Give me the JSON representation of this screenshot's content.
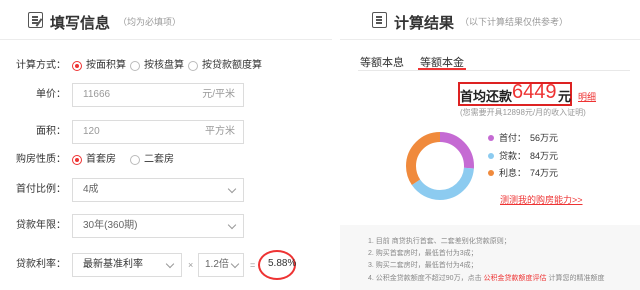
{
  "left": {
    "title": "填写信息",
    "subtitle": "（均为必填项）",
    "calc_method": {
      "label": "计算方式：",
      "options": [
        "按面积算",
        "按核盘算",
        "按贷款额度算"
      ],
      "selected": 0
    },
    "unit_price": {
      "label": "单价：",
      "placeholder": "11666",
      "unit": "元/平米"
    },
    "area": {
      "label": "面积：",
      "placeholder": "120",
      "unit": "平方米"
    },
    "house_type": {
      "label": "购房性质：",
      "options": [
        "首套房",
        "二套房"
      ],
      "selected": 0
    },
    "down_payment": {
      "label": "首付比例：",
      "value": "4成"
    },
    "loan_term": {
      "label": "贷款年限：",
      "value": "30年(360期)"
    },
    "loan_rate": {
      "label": "贷款利率：",
      "rate_type": "最新基准利率",
      "times_sign": "×",
      "multiplier": "1.2倍",
      "equals_sign": "=",
      "result": "5.88%"
    }
  },
  "right": {
    "title": "计算结果",
    "subtitle": "（以下计算结果仅供参考）",
    "tabs": [
      "等额本息",
      "等额本金"
    ],
    "active_tab": 1,
    "summary": {
      "label": "首均还款",
      "value": "6449",
      "unit": "元",
      "detail_link": "明细",
      "note": "(您需要开具12898元/月的收入证明)"
    },
    "breakdown": [
      {
        "name": "首付：",
        "value": "56万元",
        "amount": 56,
        "color": "#c56ad3"
      },
      {
        "name": "贷款：",
        "value": "84万元",
        "amount": 84,
        "color": "#8ccbf0"
      },
      {
        "name": "利息：",
        "value": "74万元",
        "amount": 74,
        "color": "#f08a3c"
      }
    ],
    "test_link": "测测我的购房能力>>",
    "notes": [
      "1. 目前 商贷执行首套、二套差别化贷款原则；",
      "2. 购买首套房时，最低首付为3成；",
      "3. 购买二套房时，最低首付为4成；"
    ],
    "note4_pre": "4. 公积金贷款额度不超过90万，点击 ",
    "note4_link": "公积金贷款额度评估",
    "note4_post": " 计算您的精准额度"
  }
}
